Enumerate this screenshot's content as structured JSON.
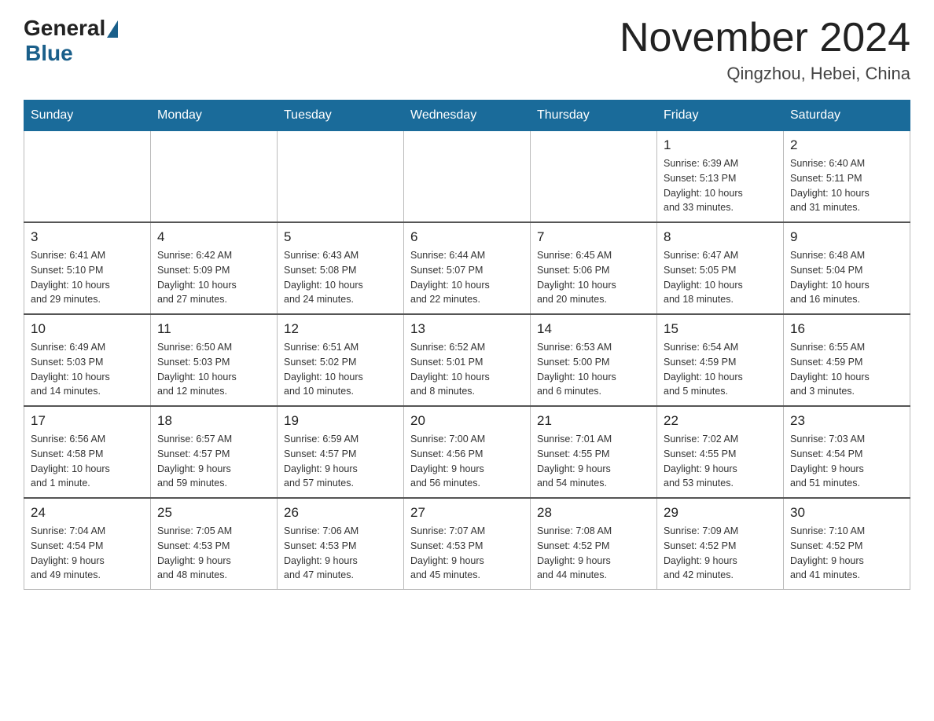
{
  "logo": {
    "general": "General",
    "blue": "Blue"
  },
  "title": "November 2024",
  "location": "Qingzhou, Hebei, China",
  "weekdays": [
    "Sunday",
    "Monday",
    "Tuesday",
    "Wednesday",
    "Thursday",
    "Friday",
    "Saturday"
  ],
  "weeks": [
    [
      {
        "day": "",
        "info": ""
      },
      {
        "day": "",
        "info": ""
      },
      {
        "day": "",
        "info": ""
      },
      {
        "day": "",
        "info": ""
      },
      {
        "day": "",
        "info": ""
      },
      {
        "day": "1",
        "info": "Sunrise: 6:39 AM\nSunset: 5:13 PM\nDaylight: 10 hours\nand 33 minutes."
      },
      {
        "day": "2",
        "info": "Sunrise: 6:40 AM\nSunset: 5:11 PM\nDaylight: 10 hours\nand 31 minutes."
      }
    ],
    [
      {
        "day": "3",
        "info": "Sunrise: 6:41 AM\nSunset: 5:10 PM\nDaylight: 10 hours\nand 29 minutes."
      },
      {
        "day": "4",
        "info": "Sunrise: 6:42 AM\nSunset: 5:09 PM\nDaylight: 10 hours\nand 27 minutes."
      },
      {
        "day": "5",
        "info": "Sunrise: 6:43 AM\nSunset: 5:08 PM\nDaylight: 10 hours\nand 24 minutes."
      },
      {
        "day": "6",
        "info": "Sunrise: 6:44 AM\nSunset: 5:07 PM\nDaylight: 10 hours\nand 22 minutes."
      },
      {
        "day": "7",
        "info": "Sunrise: 6:45 AM\nSunset: 5:06 PM\nDaylight: 10 hours\nand 20 minutes."
      },
      {
        "day": "8",
        "info": "Sunrise: 6:47 AM\nSunset: 5:05 PM\nDaylight: 10 hours\nand 18 minutes."
      },
      {
        "day": "9",
        "info": "Sunrise: 6:48 AM\nSunset: 5:04 PM\nDaylight: 10 hours\nand 16 minutes."
      }
    ],
    [
      {
        "day": "10",
        "info": "Sunrise: 6:49 AM\nSunset: 5:03 PM\nDaylight: 10 hours\nand 14 minutes."
      },
      {
        "day": "11",
        "info": "Sunrise: 6:50 AM\nSunset: 5:03 PM\nDaylight: 10 hours\nand 12 minutes."
      },
      {
        "day": "12",
        "info": "Sunrise: 6:51 AM\nSunset: 5:02 PM\nDaylight: 10 hours\nand 10 minutes."
      },
      {
        "day": "13",
        "info": "Sunrise: 6:52 AM\nSunset: 5:01 PM\nDaylight: 10 hours\nand 8 minutes."
      },
      {
        "day": "14",
        "info": "Sunrise: 6:53 AM\nSunset: 5:00 PM\nDaylight: 10 hours\nand 6 minutes."
      },
      {
        "day": "15",
        "info": "Sunrise: 6:54 AM\nSunset: 4:59 PM\nDaylight: 10 hours\nand 5 minutes."
      },
      {
        "day": "16",
        "info": "Sunrise: 6:55 AM\nSunset: 4:59 PM\nDaylight: 10 hours\nand 3 minutes."
      }
    ],
    [
      {
        "day": "17",
        "info": "Sunrise: 6:56 AM\nSunset: 4:58 PM\nDaylight: 10 hours\nand 1 minute."
      },
      {
        "day": "18",
        "info": "Sunrise: 6:57 AM\nSunset: 4:57 PM\nDaylight: 9 hours\nand 59 minutes."
      },
      {
        "day": "19",
        "info": "Sunrise: 6:59 AM\nSunset: 4:57 PM\nDaylight: 9 hours\nand 57 minutes."
      },
      {
        "day": "20",
        "info": "Sunrise: 7:00 AM\nSunset: 4:56 PM\nDaylight: 9 hours\nand 56 minutes."
      },
      {
        "day": "21",
        "info": "Sunrise: 7:01 AM\nSunset: 4:55 PM\nDaylight: 9 hours\nand 54 minutes."
      },
      {
        "day": "22",
        "info": "Sunrise: 7:02 AM\nSunset: 4:55 PM\nDaylight: 9 hours\nand 53 minutes."
      },
      {
        "day": "23",
        "info": "Sunrise: 7:03 AM\nSunset: 4:54 PM\nDaylight: 9 hours\nand 51 minutes."
      }
    ],
    [
      {
        "day": "24",
        "info": "Sunrise: 7:04 AM\nSunset: 4:54 PM\nDaylight: 9 hours\nand 49 minutes."
      },
      {
        "day": "25",
        "info": "Sunrise: 7:05 AM\nSunset: 4:53 PM\nDaylight: 9 hours\nand 48 minutes."
      },
      {
        "day": "26",
        "info": "Sunrise: 7:06 AM\nSunset: 4:53 PM\nDaylight: 9 hours\nand 47 minutes."
      },
      {
        "day": "27",
        "info": "Sunrise: 7:07 AM\nSunset: 4:53 PM\nDaylight: 9 hours\nand 45 minutes."
      },
      {
        "day": "28",
        "info": "Sunrise: 7:08 AM\nSunset: 4:52 PM\nDaylight: 9 hours\nand 44 minutes."
      },
      {
        "day": "29",
        "info": "Sunrise: 7:09 AM\nSunset: 4:52 PM\nDaylight: 9 hours\nand 42 minutes."
      },
      {
        "day": "30",
        "info": "Sunrise: 7:10 AM\nSunset: 4:52 PM\nDaylight: 9 hours\nand 41 minutes."
      }
    ]
  ]
}
